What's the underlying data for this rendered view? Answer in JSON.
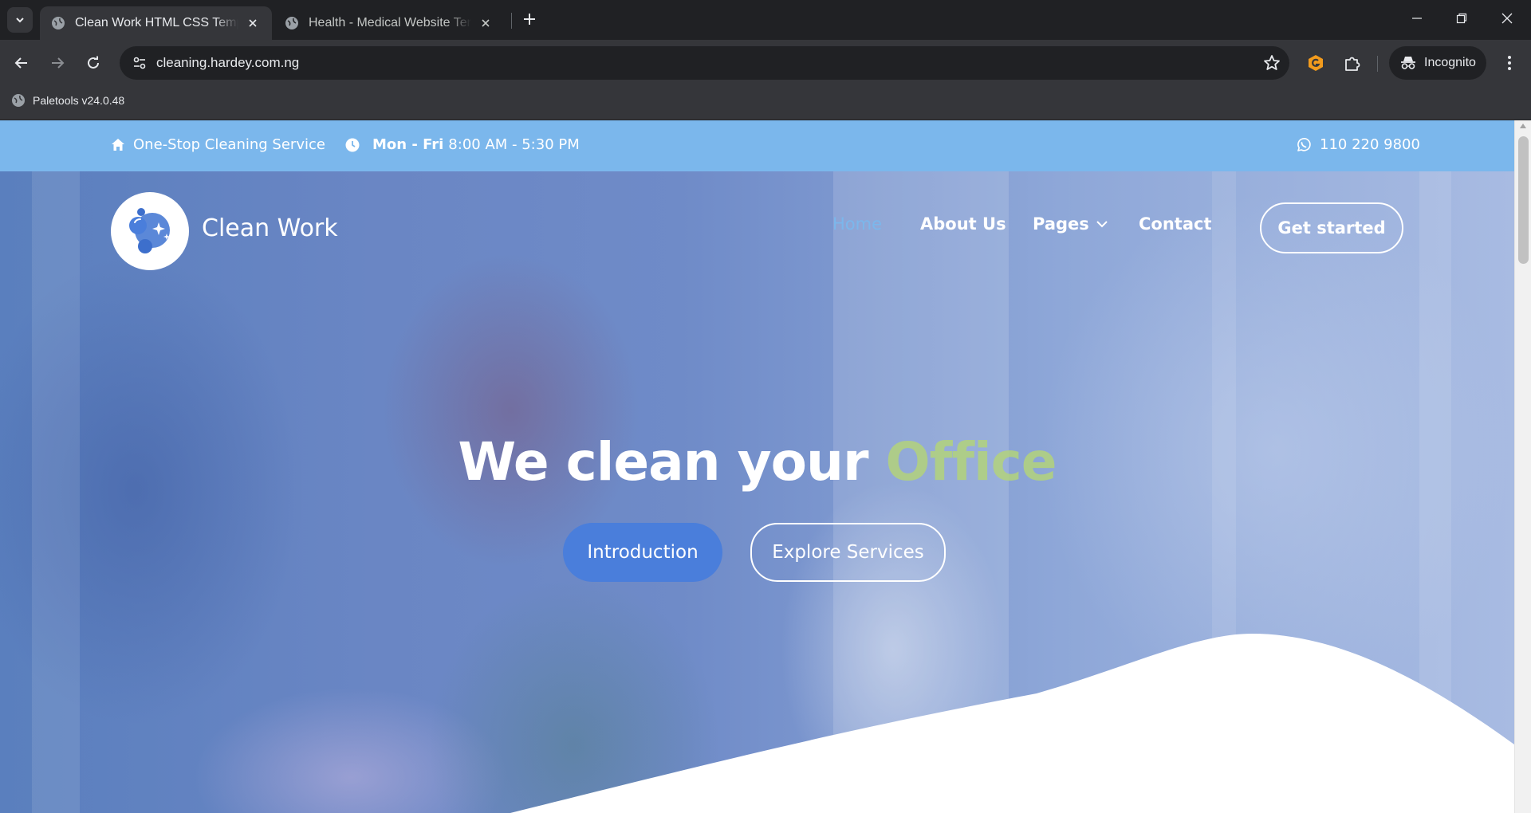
{
  "browser": {
    "tabs": [
      {
        "title": "Clean Work HTML CSS Template",
        "active": true
      },
      {
        "title": "Health - Medical Website Template",
        "active": false
      }
    ],
    "url": "cleaning.hardey.com.ng",
    "profile_label": "Incognito",
    "bookmarks": [
      {
        "label": "Paletools v24.0.48"
      }
    ],
    "icons": [
      "tab-search-icon",
      "globe-icon",
      "close-icon",
      "plus-icon",
      "minimize-icon",
      "restore-icon",
      "back-icon",
      "forward-icon",
      "reload-icon",
      "site-info-icon",
      "star-icon",
      "extension-g-icon",
      "puzzle-icon",
      "incognito-icon",
      "kebab-menu-icon"
    ]
  },
  "page": {
    "topbar": {
      "tagline": "One-Stop Cleaning Service",
      "days": "Mon - Fri",
      "hours": "8:00 AM - 5:30 PM",
      "phone": "110 220 9800"
    },
    "brand": "Clean Work",
    "nav": [
      {
        "label": "Home",
        "active": true
      },
      {
        "label": "About Us"
      },
      {
        "label": "Pages",
        "has_dropdown": true
      },
      {
        "label": "Contact"
      }
    ],
    "cta": "Get started",
    "hero": {
      "headline": "We clean your",
      "headline_accent": "Office",
      "primary_button": "Introduction",
      "secondary_button": "Explore Services"
    },
    "colors": {
      "topbar": "#7bb7ec",
      "primary_button": "#4a7edb",
      "accent_text": "#b3d37c",
      "active_nav": "#7bb7ec"
    }
  }
}
